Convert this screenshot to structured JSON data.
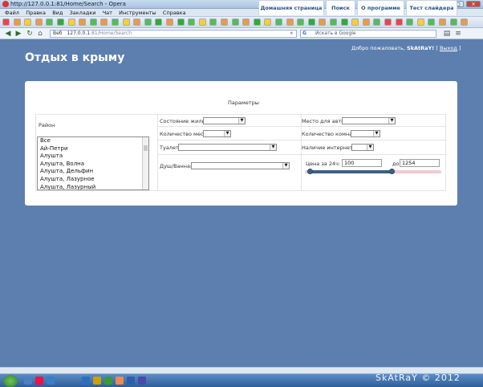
{
  "window": {
    "title": "http://127.0.0.1:81/Home/Search - Opera",
    "min": "–",
    "max": "□",
    "close": "✕"
  },
  "menu": [
    "Файл",
    "Правка",
    "Вид",
    "Закладки",
    "Чат",
    "Инструменты",
    "Справка"
  ],
  "address": {
    "badge": "Веб",
    "url_host": "127.0.0.1",
    "url_path": ":81/Home/Search",
    "search_placeholder": "Искать в Google",
    "search_engine": "G"
  },
  "site": {
    "title": "Отдых в крыму",
    "welcome_prefix": "Добро пожаловать,",
    "user": "SkAtRaY!",
    "logout": "Выход",
    "bracket_open": "[",
    "bracket_close": "]"
  },
  "tabs": [
    "Домашняя страница",
    "Поиск",
    "О программе",
    "Тест слайдера"
  ],
  "form": {
    "heading": "Параметры",
    "district_label": "Район",
    "districts": [
      "Все",
      "Ай-Петри",
      "Алушта",
      "Алушта, Волна",
      "Алушта, Дельфин",
      "Алушта, Лазурное",
      "Алушта, Лазурный"
    ],
    "housing_state_label": "Состояние жилья",
    "places_label": "Количество мест",
    "toilet_label": "Туалет",
    "shower_label": "Душ/Ванная",
    "parking_label": "Место для авто",
    "rooms_label": "Количество комнат",
    "internet_label": "Наличие интернета",
    "price_label": "Цена за 24ч: от",
    "price_from": "100",
    "price_to_label": "до",
    "price_to": "1254",
    "slider_min_fraction": 0.04,
    "slider_max_fraction": 0.64
  },
  "watermark": "SkAtRaY © 2012",
  "colors": {
    "page_bg": "#5c7fb0",
    "tab_text": "#2a4f86",
    "slider": "#3c5f86",
    "slider_track": "#f2c9d0"
  }
}
